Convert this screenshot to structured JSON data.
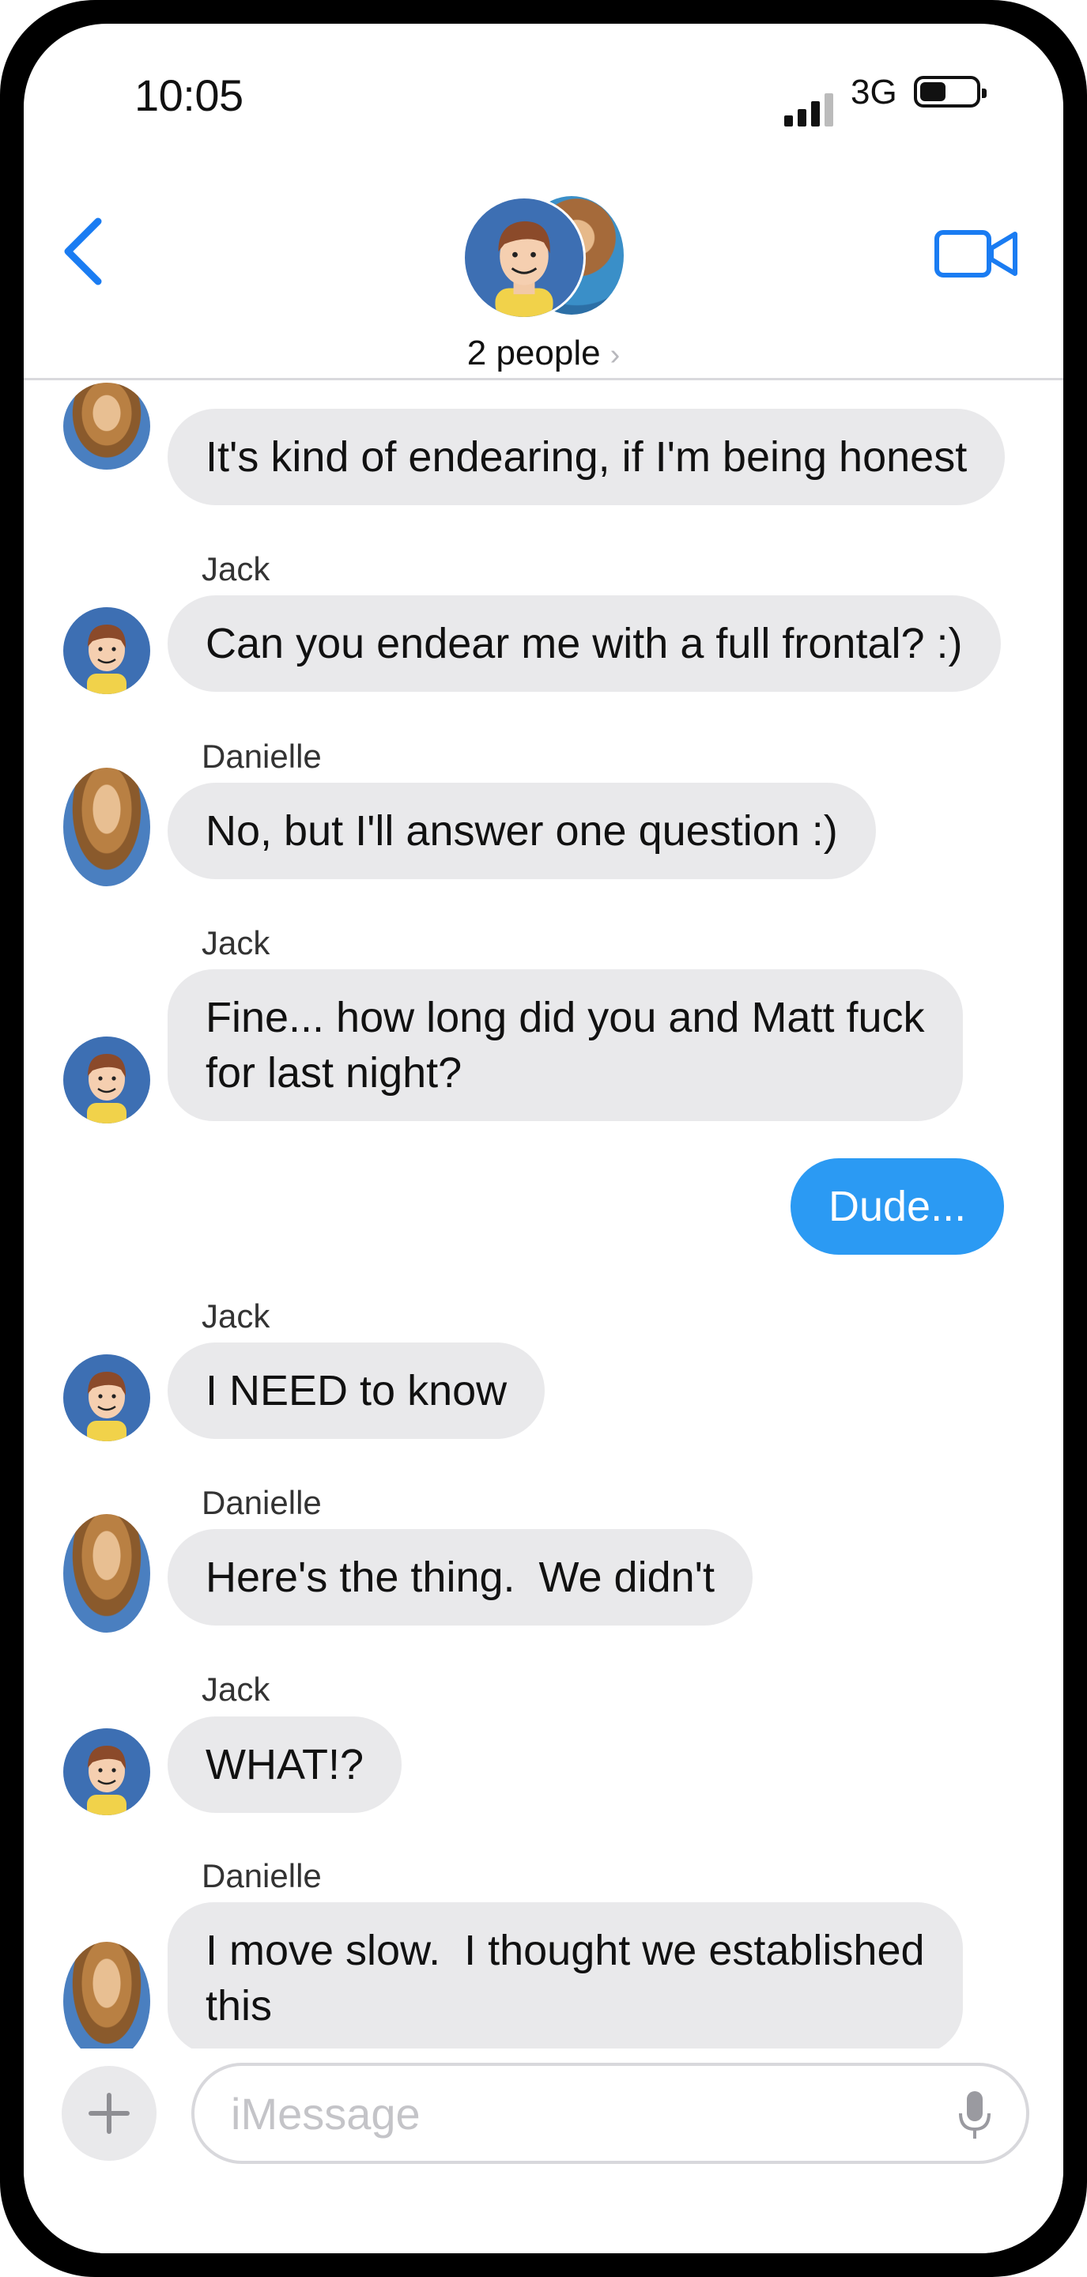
{
  "status_bar": {
    "time": "10:05",
    "network": "3G"
  },
  "header": {
    "title": "2 people",
    "back_icon": "chevron-left-icon",
    "video_icon": "video-camera-icon",
    "chevron": "›"
  },
  "messages": [
    {
      "sender": "",
      "text": "It's kind of endearing, if I'm being honest",
      "from": "danielle"
    },
    {
      "sender": "Jack",
      "text": "Can you endear me with a full frontal? :)",
      "from": "jack"
    },
    {
      "sender": "Danielle",
      "text": "No, but I'll answer one question :)",
      "from": "danielle"
    },
    {
      "sender": "Jack",
      "text": "Fine... how long did you and Matt fuck\nfor last night?",
      "from": "jack"
    },
    {
      "sender": "",
      "text": "Dude...",
      "from": "me"
    },
    {
      "sender": "Jack",
      "text": "I NEED to know",
      "from": "jack"
    },
    {
      "sender": "Danielle",
      "text": "Here's the thing.  We didn't",
      "from": "danielle"
    },
    {
      "sender": "Jack",
      "text": "WHAT!?",
      "from": "jack"
    },
    {
      "sender": "Danielle",
      "text": "I move slow.  I thought we established\nthis",
      "from": "danielle"
    }
  ],
  "composer": {
    "placeholder": "iMessage",
    "plus_icon": "plus-icon",
    "mic_icon": "microphone-icon"
  },
  "colors": {
    "outgoing_bubble": "#2b9af3",
    "incoming_bubble": "#e9e9eb",
    "accent": "#1a7cf2"
  }
}
